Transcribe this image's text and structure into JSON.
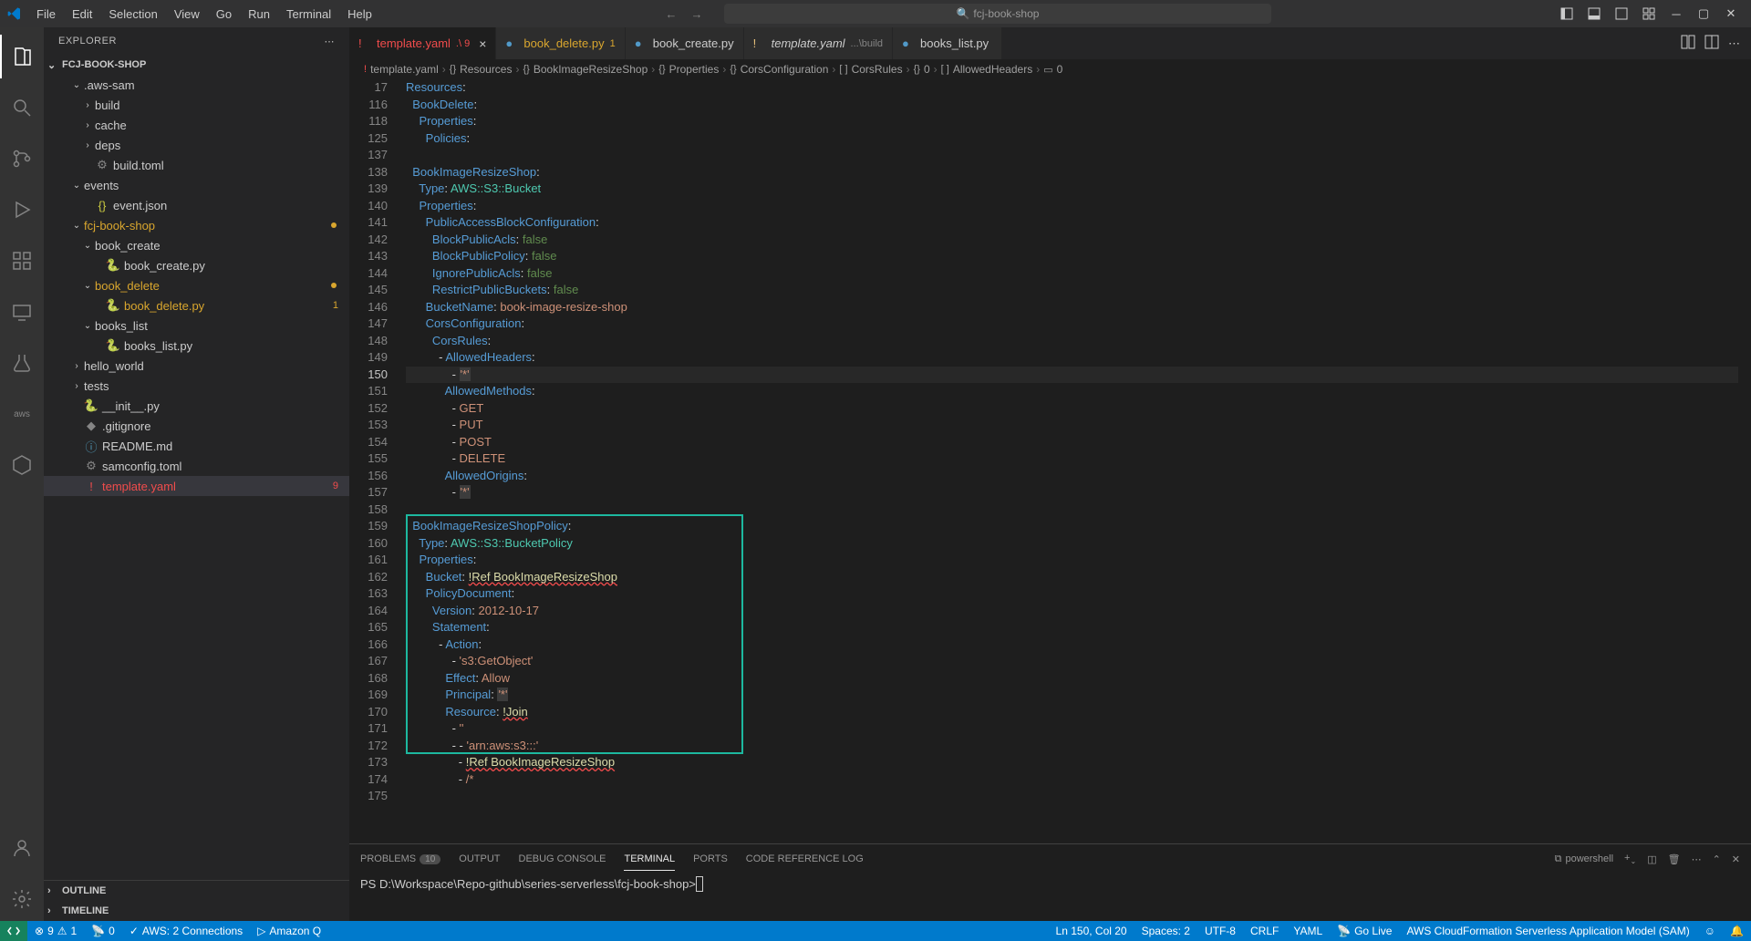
{
  "titlebar": {
    "menu": [
      "File",
      "Edit",
      "Selection",
      "View",
      "Go",
      "Run",
      "Terminal",
      "Help"
    ],
    "search": "fcj-book-shop"
  },
  "sidebar": {
    "title": "EXPLORER",
    "root": "FCJ-BOOK-SHOP",
    "tree": [
      {
        "t": "folder",
        "l": ".aws-sam",
        "d": 2,
        "open": true
      },
      {
        "t": "folder",
        "l": "build",
        "d": 3,
        "open": false
      },
      {
        "t": "folder",
        "l": "cache",
        "d": 3,
        "open": false
      },
      {
        "t": "folder",
        "l": "deps",
        "d": 3,
        "open": false
      },
      {
        "t": "file",
        "l": "build.toml",
        "d": 3,
        "i": "⚙",
        "ic": "#858585"
      },
      {
        "t": "folder",
        "l": "events",
        "d": 2,
        "open": true
      },
      {
        "t": "file",
        "l": "event.json",
        "d": 3,
        "i": "{}",
        "ic": "#cbcb41"
      },
      {
        "t": "folder",
        "l": "fcj-book-shop",
        "d": 2,
        "open": true,
        "c": "#d9a62e",
        "dot": "#d9a62e"
      },
      {
        "t": "folder",
        "l": "book_create",
        "d": 3,
        "open": true
      },
      {
        "t": "file",
        "l": "book_create.py",
        "d": 4,
        "i": "🐍",
        "ic": "#5199c8"
      },
      {
        "t": "folder",
        "l": "book_delete",
        "d": 3,
        "open": true,
        "c": "#d9a62e",
        "dot": "#d9a62e"
      },
      {
        "t": "file",
        "l": "book_delete.py",
        "d": 4,
        "i": "🐍",
        "ic": "#5199c8",
        "c": "#d9a62e",
        "badge": "1",
        "bc": "#d9a62e"
      },
      {
        "t": "folder",
        "l": "books_list",
        "d": 3,
        "open": true
      },
      {
        "t": "file",
        "l": "books_list.py",
        "d": 4,
        "i": "🐍",
        "ic": "#5199c8"
      },
      {
        "t": "folder",
        "l": "hello_world",
        "d": 2,
        "open": false
      },
      {
        "t": "folder",
        "l": "tests",
        "d": 2,
        "open": false
      },
      {
        "t": "file",
        "l": "__init__.py",
        "d": 2,
        "i": "🐍",
        "ic": "#5199c8"
      },
      {
        "t": "file",
        "l": ".gitignore",
        "d": 2,
        "i": "◆",
        "ic": "#858585"
      },
      {
        "t": "file",
        "l": "README.md",
        "d": 2,
        "i": "ⓘ",
        "ic": "#519aba"
      },
      {
        "t": "file",
        "l": "samconfig.toml",
        "d": 2,
        "i": "⚙",
        "ic": "#858585"
      },
      {
        "t": "file",
        "l": "template.yaml",
        "d": 2,
        "i": "!",
        "ic": "#f14c4c",
        "c": "#f14c4c",
        "badge": "9",
        "bc": "#f14c4c",
        "sel": true
      }
    ],
    "outline": "OUTLINE",
    "timeline": "TIMELINE"
  },
  "tabs": [
    {
      "label": "template.yaml",
      "sub": ".\\ 9",
      "i": "!",
      "ic": "#f14c4c",
      "c": "#f14c4c",
      "active": true,
      "close": true
    },
    {
      "label": "book_delete.py",
      "sub": "1",
      "i": "●",
      "ic": "#5199c8",
      "c": "#d9a62e"
    },
    {
      "label": "book_create.py",
      "i": "●",
      "ic": "#5199c8"
    },
    {
      "label": "template.yaml",
      "sub": "...\\build",
      "i": "!",
      "ic": "#e6c07b",
      "it": true
    },
    {
      "label": "books_list.py",
      "i": "●",
      "ic": "#5199c8"
    }
  ],
  "breadcrumb": [
    {
      "i": "!",
      "l": "template.yaml",
      "ic": "#f14c4c"
    },
    {
      "i": "{}",
      "l": "Resources"
    },
    {
      "i": "{}",
      "l": "BookImageResizeShop"
    },
    {
      "i": "{}",
      "l": "Properties"
    },
    {
      "i": "{}",
      "l": "CorsConfiguration"
    },
    {
      "i": "[ ]",
      "l": "CorsRules"
    },
    {
      "i": "{}",
      "l": "0"
    },
    {
      "i": "[ ]",
      "l": "AllowedHeaders"
    },
    {
      "i": "▭",
      "l": "0"
    }
  ],
  "code": {
    "lines": [
      {
        "n": 17,
        "h": "<span class='k'>Resources</span><span class='p'>:</span>"
      },
      {
        "n": 116,
        "h": "  <span class='k'>BookDelete</span><span class='p'>:</span>"
      },
      {
        "n": 118,
        "h": "    <span class='k'>Properties</span><span class='p'>:</span>"
      },
      {
        "n": 125,
        "h": "      <span class='k'>Policies</span><span class='p'>:</span>"
      },
      {
        "n": 137,
        "h": ""
      },
      {
        "n": 138,
        "h": "  <span class='k'>BookImageResizeShop</span><span class='p'>:</span>"
      },
      {
        "n": 139,
        "h": "    <span class='k'>Type</span><span class='p'>:</span> <span class='t'>AWS::S3::Bucket</span>"
      },
      {
        "n": 140,
        "h": "    <span class='k'>Properties</span><span class='p'>:</span>"
      },
      {
        "n": 141,
        "h": "      <span class='k'>PublicAccessBlockConfiguration</span><span class='p'>:</span>"
      },
      {
        "n": 142,
        "h": "        <span class='k'>BlockPublicAcls</span><span class='p'>:</span> <span class='c'>false</span>"
      },
      {
        "n": 143,
        "h": "        <span class='k'>BlockPublicPolicy</span><span class='p'>:</span> <span class='c'>false</span>"
      },
      {
        "n": 144,
        "h": "        <span class='k'>IgnorePublicAcls</span><span class='p'>:</span> <span class='c'>false</span>"
      },
      {
        "n": 145,
        "h": "        <span class='k'>RestrictPublicBuckets</span><span class='p'>:</span> <span class='c'>false</span>"
      },
      {
        "n": 146,
        "h": "      <span class='k'>BucketName</span><span class='p'>:</span> <span class='s'>book-image-resize-shop</span>"
      },
      {
        "n": 147,
        "h": "      <span class='k'>CorsConfiguration</span><span class='p'>:</span>"
      },
      {
        "n": 148,
        "h": "        <span class='k'>CorsRules</span><span class='p'>:</span>"
      },
      {
        "n": 149,
        "h": "          <span class='p'>-</span> <span class='k'>AllowedHeaders</span><span class='p'>:</span>"
      },
      {
        "n": 150,
        "h": "              <span class='p'>-</span> <span class='s quoted'>'*'</span>",
        "cur": true
      },
      {
        "n": 151,
        "h": "            <span class='k'>AllowedMethods</span><span class='p'>:</span>"
      },
      {
        "n": 152,
        "h": "              <span class='p'>-</span> <span class='s'>GET</span>"
      },
      {
        "n": 153,
        "h": "              <span class='p'>-</span> <span class='s'>PUT</span>"
      },
      {
        "n": 154,
        "h": "              <span class='p'>-</span> <span class='s'>POST</span>"
      },
      {
        "n": 155,
        "h": "              <span class='p'>-</span> <span class='s'>DELETE</span>"
      },
      {
        "n": 156,
        "h": "            <span class='k'>AllowedOrigins</span><span class='p'>:</span>"
      },
      {
        "n": 157,
        "h": "              <span class='p'>-</span> <span class='s quoted'>'*'</span>"
      },
      {
        "n": 158,
        "h": ""
      },
      {
        "n": 159,
        "h": "  <span class='k'>BookImageResizeShopPolicy</span><span class='p'>:</span>"
      },
      {
        "n": 160,
        "h": "    <span class='k'>Type</span><span class='p'>:</span> <span class='t'>AWS::S3::BucketPolicy</span>"
      },
      {
        "n": 161,
        "h": "    <span class='k'>Properties</span><span class='p'>:</span>"
      },
      {
        "n": 162,
        "h": "      <span class='k'>Bucket</span><span class='p'>:</span> <span class='y err'>!Ref BookImageResizeShop</span>"
      },
      {
        "n": 163,
        "h": "      <span class='k'>PolicyDocument</span><span class='p'>:</span>"
      },
      {
        "n": 164,
        "h": "        <span class='k'>Version</span><span class='p'>:</span> <span class='s'>2012-10-17</span>"
      },
      {
        "n": 165,
        "h": "        <span class='k'>Statement</span><span class='p'>:</span>"
      },
      {
        "n": 166,
        "h": "          <span class='p'>-</span> <span class='k'>Action</span><span class='p'>:</span>"
      },
      {
        "n": 167,
        "h": "              <span class='p'>-</span> <span class='s'>'s3:GetObject'</span>"
      },
      {
        "n": 168,
        "h": "            <span class='k'>Effect</span><span class='p'>:</span> <span class='s'>Allow</span>"
      },
      {
        "n": 169,
        "h": "            <span class='k'>Principal</span><span class='p'>:</span> <span class='s quoted'>'*'</span>"
      },
      {
        "n": 170,
        "h": "            <span class='k'>Resource</span><span class='p'>:</span> <span class='y err'>!Join</span>"
      },
      {
        "n": 171,
        "h": "              <span class='p'>-</span> <span class='s'>''</span>"
      },
      {
        "n": 172,
        "h": "              <span class='p'>-</span> <span class='p'>-</span> <span class='s'>'arn:aws:s3:::'</span>"
      },
      {
        "n": 173,
        "h": "                <span class='p'>-</span> <span class='y err'>!Ref BookImageResizeShop</span>"
      },
      {
        "n": 174,
        "h": "                <span class='p'>-</span> <span class='s'>/*</span>"
      },
      {
        "n": 175,
        "h": ""
      }
    ]
  },
  "terminal": {
    "tabs": [
      "PROBLEMS",
      "OUTPUT",
      "DEBUG CONSOLE",
      "TERMINAL",
      "PORTS",
      "CODE REFERENCE LOG"
    ],
    "problems_badge": "10",
    "shell": "powershell",
    "prompt": "PS D:\\Workspace\\Repo-github\\series-serverless\\fcj-book-shop> "
  },
  "statusbar": {
    "errors": "9",
    "warnings": "1",
    "ports": "0",
    "aws": "AWS: 2 Connections",
    "amazonq": "Amazon Q",
    "ln": "Ln 150, Col 20",
    "spaces": "Spaces: 2",
    "enc": "UTF-8",
    "eol": "CRLF",
    "lang": "YAML",
    "golive": "Go Live",
    "sam": "AWS CloudFormation Serverless Application Model (SAM)"
  }
}
